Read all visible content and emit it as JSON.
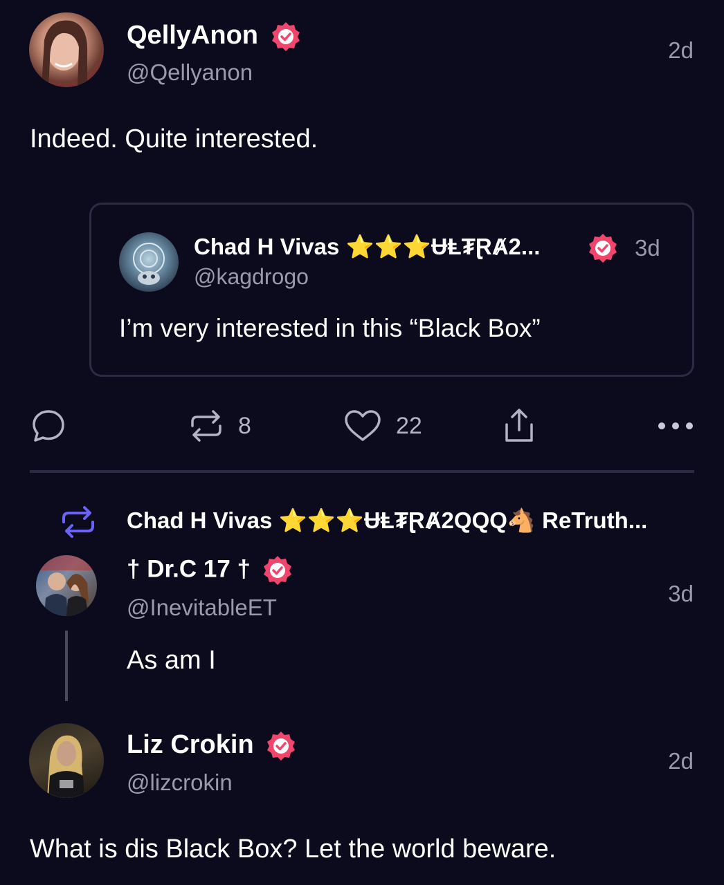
{
  "post1": {
    "name": "QellyAnon",
    "handle": "@Qellyanon",
    "time": "2d",
    "text": "Indeed. Quite interested.",
    "quote": {
      "name": "Chad H Vivas ⭐⭐⭐ɄⱠ₮ⱤȺ2...",
      "handle": "@kagdrogo",
      "time": "3d",
      "text": "I’m very interested in this “Black Box”"
    },
    "actions": {
      "retruths": "8",
      "likes": "22"
    }
  },
  "retruth_banner": {
    "text": "Chad H Vivas ⭐⭐⭐ɄⱠ₮ⱤȺ2QQQ🐴 ReTruth..."
  },
  "post2": {
    "name": "† Dr.C 17 †",
    "handle": "@InevitableET",
    "time": "3d",
    "text": "As am I"
  },
  "post3": {
    "name": "Liz Crokin",
    "handle": "@lizcrokin",
    "time": "2d",
    "text": "What is dis Black Box? Let the world beware."
  },
  "colors": {
    "background": "#0c0b1d",
    "verified_badge": "#f0456c",
    "secondary_text": "#9a99ad",
    "retruth_accent": "#6b63f5"
  }
}
